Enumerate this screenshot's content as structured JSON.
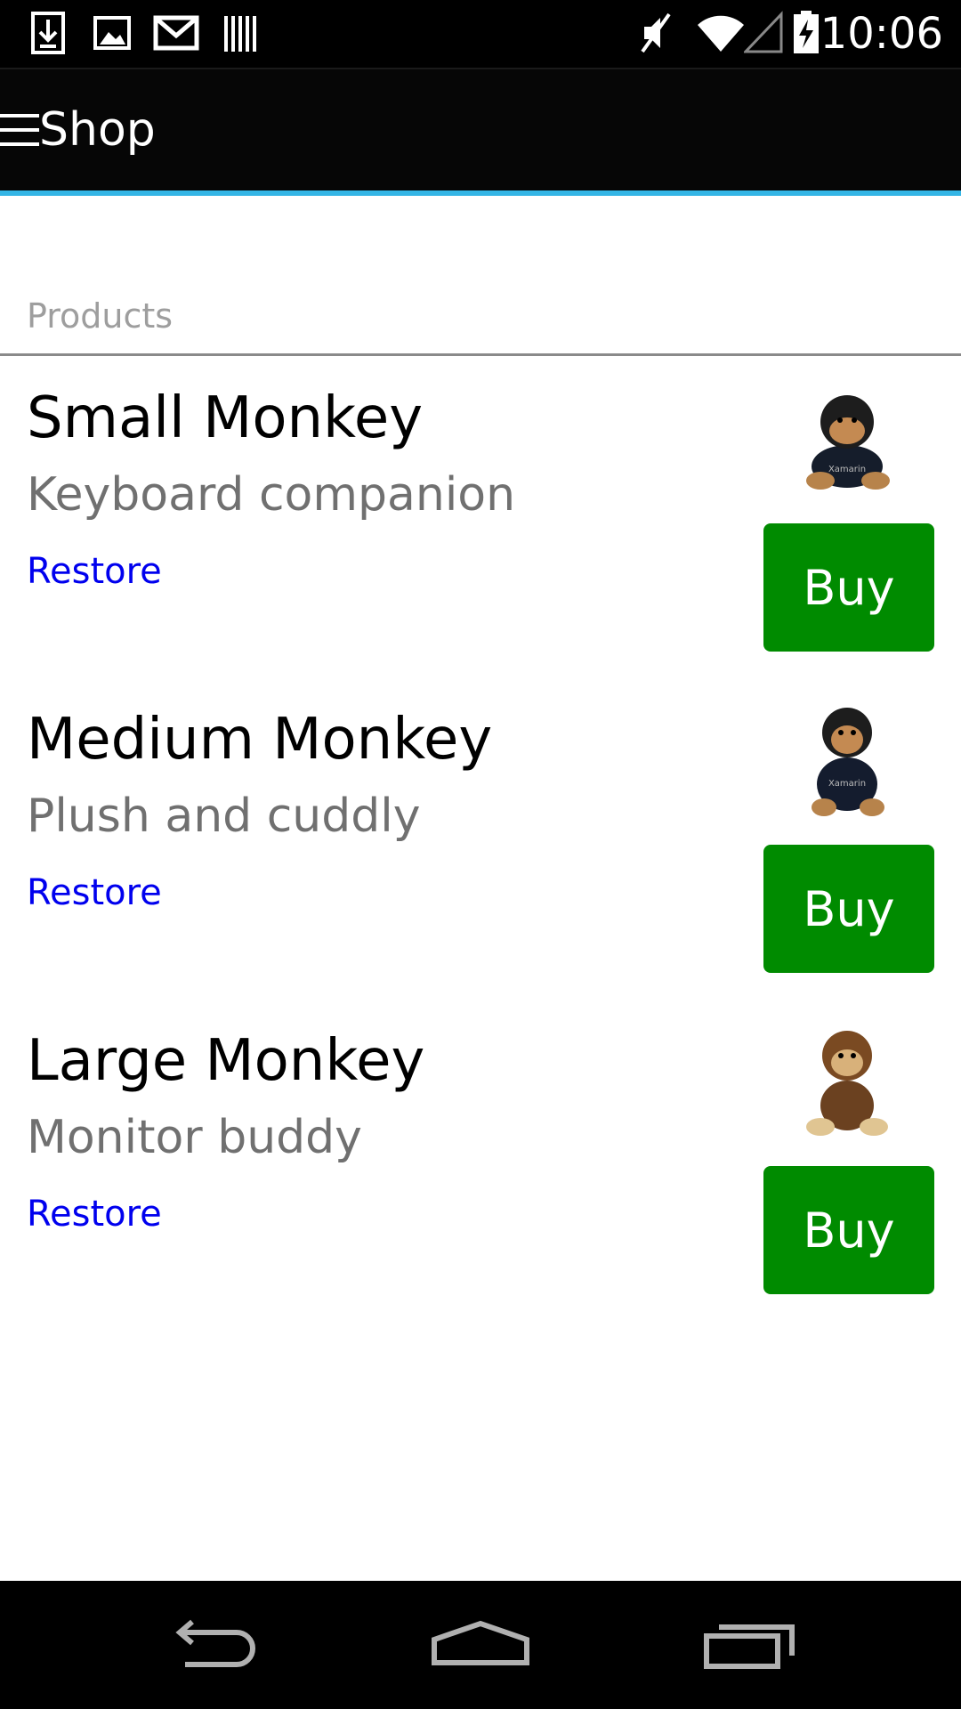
{
  "status_bar": {
    "time": "10:06",
    "icons": [
      "download-icon",
      "image-icon",
      "gmail-icon",
      "barcode-icon",
      "mute-icon",
      "wifi-icon",
      "signal-icon",
      "battery-charging-icon"
    ]
  },
  "action_bar": {
    "menu_icon": "hamburger-icon",
    "title": "Shop",
    "accent_color": "#33b5e5"
  },
  "products_section": {
    "header": "Products",
    "items": [
      {
        "name": "Small Monkey",
        "description": "Keyboard companion",
        "restore_label": "Restore",
        "buy_label": "Buy",
        "image_icon": "small-monkey-plush-icon"
      },
      {
        "name": "Medium Monkey",
        "description": "Plush and cuddly",
        "restore_label": "Restore",
        "buy_label": "Buy",
        "image_icon": "medium-monkey-plush-icon"
      },
      {
        "name": "Large Monkey",
        "description": "Monitor buddy",
        "restore_label": "Restore",
        "buy_label": "Buy",
        "image_icon": "large-monkey-plush-icon"
      }
    ]
  },
  "colors": {
    "buy_button": "#008b00",
    "restore_link": "#0000ee",
    "description_text": "#707070",
    "section_header_text": "#9e9e9e"
  },
  "nav_bar": {
    "buttons": [
      "back-icon",
      "home-icon",
      "recents-icon"
    ]
  }
}
